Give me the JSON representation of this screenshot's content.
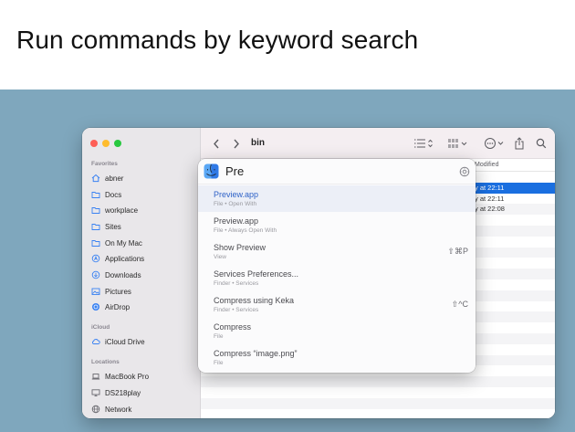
{
  "slide": {
    "title": "Run commands by keyword search"
  },
  "finder": {
    "toolbar": {
      "folder_name": "bin"
    },
    "sidebar": {
      "favorites_heading": "Favorites",
      "favorites": [
        {
          "label": "abner",
          "icon": "home-icon"
        },
        {
          "label": "Docs",
          "icon": "folder-icon"
        },
        {
          "label": "workplace",
          "icon": "folder-icon"
        },
        {
          "label": "Sites",
          "icon": "folder-icon"
        },
        {
          "label": "On My Mac",
          "icon": "folder-icon"
        },
        {
          "label": "Applications",
          "icon": "applications-icon"
        },
        {
          "label": "Downloads",
          "icon": "downloads-icon"
        },
        {
          "label": "Pictures",
          "icon": "pictures-icon"
        },
        {
          "label": "AirDrop",
          "icon": "airdrop-icon"
        }
      ],
      "icloud_heading": "iCloud",
      "icloud": [
        {
          "label": "iCloud Drive",
          "icon": "cloud-icon"
        }
      ],
      "locations_heading": "Locations",
      "locations": [
        {
          "label": "MacBook Pro",
          "icon": "laptop-icon"
        },
        {
          "label": "DS218play",
          "icon": "display-icon"
        },
        {
          "label": "Network",
          "icon": "globe-icon"
        }
      ]
    },
    "list": {
      "column_modified": "Modified",
      "visible_dates": [
        "y at 22:11",
        "y at 22:11",
        "y at 22:08"
      ]
    }
  },
  "palette": {
    "query": "Pre",
    "results": [
      {
        "title": "Preview.app",
        "subtitle": "File • Open With",
        "shortcut": ""
      },
      {
        "title": "Preview.app",
        "subtitle": "File • Always Open With",
        "shortcut": ""
      },
      {
        "title": "Show Preview",
        "subtitle": "View",
        "shortcut": "⇧⌘P"
      },
      {
        "title": "Services Preferences...",
        "subtitle": "Finder • Services",
        "shortcut": ""
      },
      {
        "title": "Compress using Keka",
        "subtitle": "Finder • Services",
        "shortcut": "⇧^C"
      },
      {
        "title": "Compress",
        "subtitle": "File",
        "shortcut": ""
      },
      {
        "title": "Compress “image.png”",
        "subtitle": "File",
        "shortcut": ""
      }
    ]
  },
  "colors": {
    "backdrop": "#7fa7bd",
    "selection": "#1a6fe0",
    "accent_text": "#2f62c7"
  }
}
